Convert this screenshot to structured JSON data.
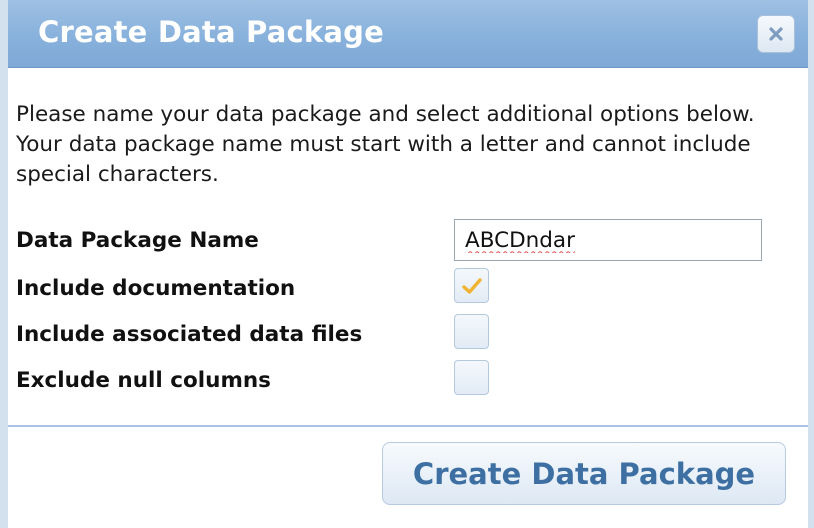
{
  "dialog": {
    "title": "Create Data Package",
    "close_icon": "close-icon"
  },
  "intro_text": "Please name your data package and select additional options below. Your data package name must start with a letter and cannot include special characters.",
  "fields": {
    "name": {
      "label": "Data Package Name",
      "value": "ABCDndar",
      "placeholder": ""
    },
    "include_documentation": {
      "label": "Include documentation",
      "checked": true
    },
    "include_associated_files": {
      "label": "Include associated data files",
      "checked": false
    },
    "exclude_null_columns": {
      "label": "Exclude null columns",
      "checked": false
    }
  },
  "actions": {
    "submit_label": "Create Data Package"
  },
  "colors": {
    "title_bar": "#88b1dc",
    "button_text": "#3d6fa2",
    "check_mark": "#f0b330",
    "separator": "#a9c4e2"
  }
}
